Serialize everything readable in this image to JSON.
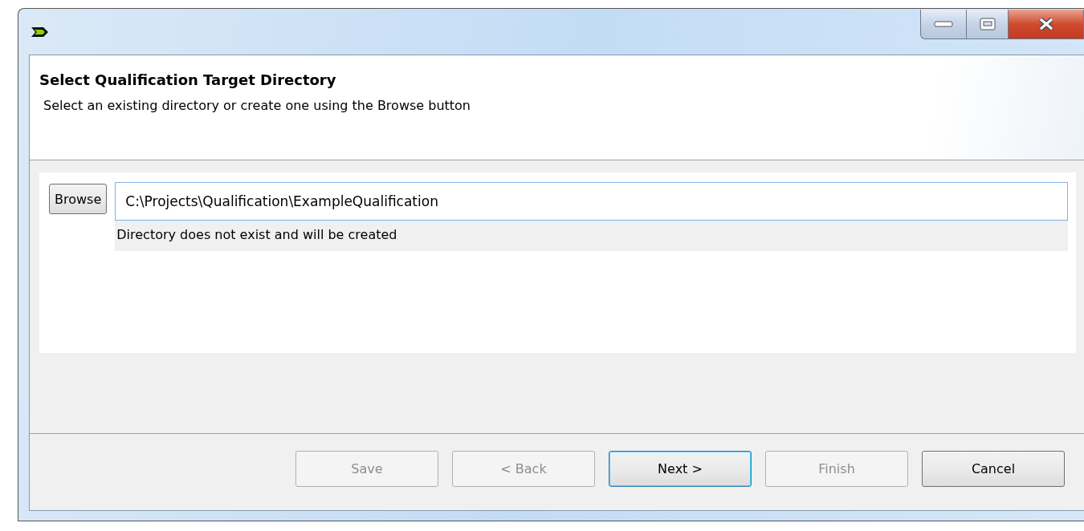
{
  "window": {
    "controls": [
      {
        "kind": "minimize"
      },
      {
        "kind": "maximize"
      },
      {
        "kind": "close"
      }
    ]
  },
  "header": {
    "title": "Select Qualification Target Directory",
    "description": "Select an existing directory or create one using the Browse button"
  },
  "directory": {
    "browse_label": "Browse",
    "value": "C:\\Projects\\Qualification\\ExampleQualification",
    "message": "Directory does not exist and will be created"
  },
  "buttons": [
    {
      "label": "Save",
      "disabled": true,
      "default": false
    },
    {
      "label": "< Back",
      "disabled": true,
      "default": false
    },
    {
      "label": "Next >",
      "disabled": false,
      "default": true
    },
    {
      "label": "Finish",
      "disabled": true,
      "default": false
    },
    {
      "label": "Cancel",
      "disabled": false,
      "default": false
    }
  ]
}
